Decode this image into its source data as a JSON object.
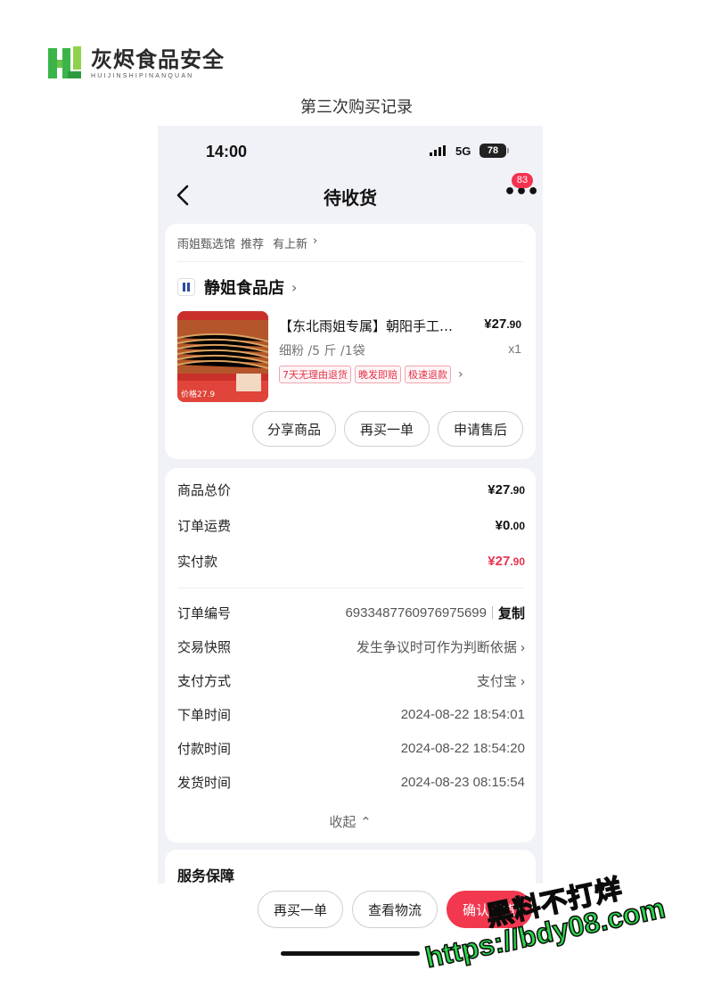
{
  "logo": {
    "title": "灰烬食品安全",
    "subtitle": "HUIJINSHIPINANQUAN"
  },
  "caption": "第三次购买记录",
  "status_bar": {
    "time": "14:00",
    "network": "5G",
    "battery": "78"
  },
  "nav": {
    "title": "待收货",
    "more_icon": "more-dots-icon",
    "badge": "83"
  },
  "recommend": {
    "source": "雨姐甄选馆",
    "label": "推荐",
    "new_link": "有上新"
  },
  "shop": {
    "name": "静姐食品店"
  },
  "product": {
    "title": "【东北雨姐专属】朝阳手工地瓜粉条",
    "price_int": "¥27",
    "price_dec": ".90",
    "spec": "细粉 /5 斤 /1袋",
    "qty": "x1",
    "tags": [
      "7天无理由退货",
      "晚发即赔",
      "极速退款"
    ],
    "thumb_price": "价格27.9"
  },
  "actions": {
    "share": "分享商品",
    "rebuy": "再买一单",
    "after_sale": "申请售后"
  },
  "summary": {
    "goods_total_label": "商品总价",
    "goods_total_int": "¥27",
    "goods_total_dec": ".90",
    "shipping_label": "订单运费",
    "shipping_int": "¥0",
    "shipping_dec": ".00",
    "paid_label": "实付款",
    "paid_int": "¥27",
    "paid_dec": ".90"
  },
  "order": {
    "no_label": "订单编号",
    "no_value": "6933487760976975699",
    "copy": "复制",
    "snapshot_label": "交易快照",
    "snapshot_value": "发生争议时可作为判断依据",
    "pay_label": "支付方式",
    "pay_value": "支付宝",
    "order_time_label": "下单时间",
    "order_time": "2024-08-22 18:54:01",
    "pay_time_label": "付款时间",
    "pay_time": "2024-08-22 18:54:20",
    "ship_time_label": "发货时间",
    "ship_time": "2024-08-23 08:15:54",
    "collapse": "收起"
  },
  "service": {
    "title": "服务保障"
  },
  "bottom": {
    "rebuy": "再买一单",
    "logistics": "查看物流",
    "confirm": "确认收货"
  },
  "watermark": {
    "line1": "黑料不打烊",
    "line2": "https://bdy08.com"
  },
  "colors": {
    "accent": "#f1384f",
    "logo_green": "#3bb54a",
    "watermark_green": "#2ad54a"
  }
}
